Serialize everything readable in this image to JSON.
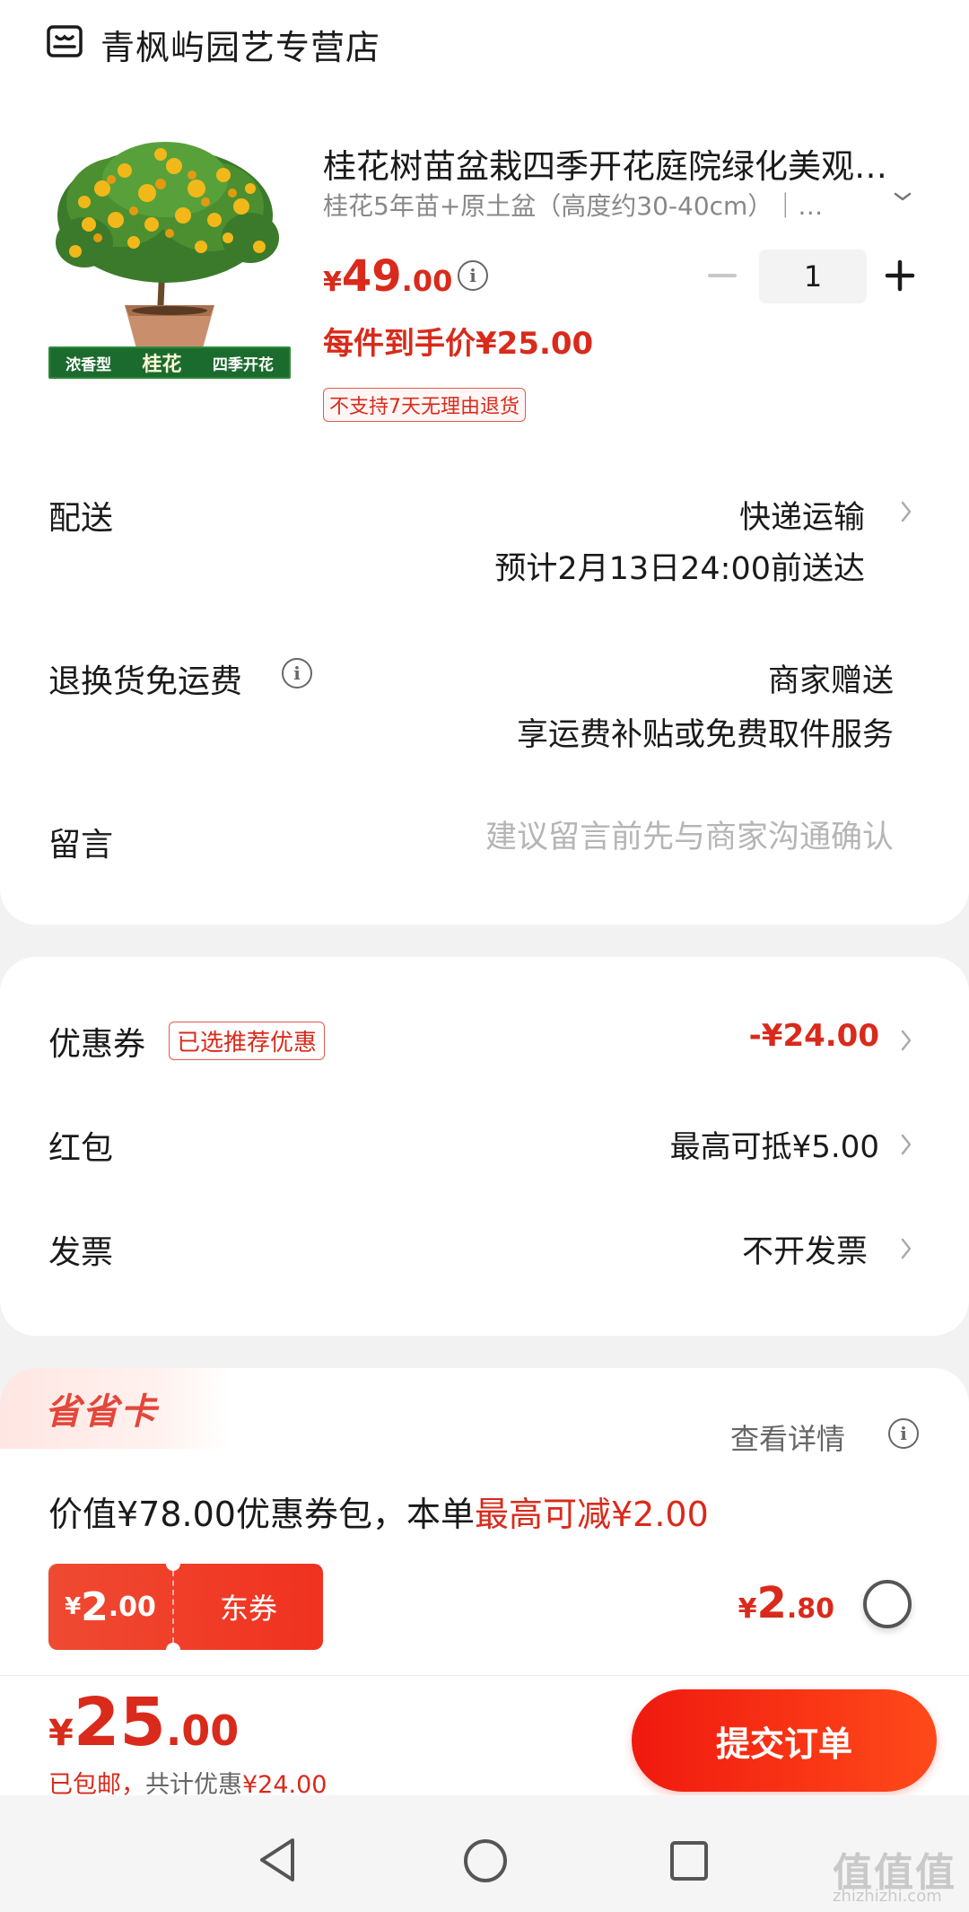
{
  "store": {
    "name": "青枫屿园艺专营店",
    "icon": "store-icon"
  },
  "product": {
    "title": "桂花树苗盆栽四季开花庭院绿化美观…",
    "spec": "桂花5年苗+原土盆（高度约30-40cm）｜…",
    "image_banner": {
      "left": "浓香型",
      "center": "桂花",
      "right": "四季开花"
    },
    "price": {
      "symbol": "¥",
      "integer": "49",
      "decimal": ".00"
    },
    "final_price": "每件到手价¥25.00",
    "return_policy": "不支持7天无理由退货",
    "quantity": "1"
  },
  "shipping": {
    "label": "配送",
    "method": "快递运输",
    "eta": "预计2月13日24:00前送达"
  },
  "return_shipping": {
    "label": "退换货免运费",
    "value": "商家赠送",
    "desc": "享运费补贴或免费取件服务"
  },
  "message": {
    "label": "留言",
    "placeholder": "建议留言前先与商家沟通确认"
  },
  "coupon": {
    "label": "优惠券",
    "badge": "已选推荐优惠",
    "value": "-¥24.00"
  },
  "red_packet": {
    "label": "红包",
    "value": "最高可抵¥5.00"
  },
  "invoice": {
    "label": "发票",
    "value": "不开发票"
  },
  "savings_card": {
    "title": "省省卡",
    "detail": "查看详情",
    "desc_prefix": "价值¥78.00优惠券包，本单",
    "desc_highlight": "最高可减¥2.00",
    "ticket": {
      "symbol": "¥",
      "integer": "2",
      "decimal": ".00",
      "label": "东券"
    },
    "price": {
      "symbol": "¥",
      "integer": "2",
      "decimal": ".80"
    }
  },
  "summary": {
    "total": {
      "symbol": "¥",
      "integer": "25",
      "decimal": ".00"
    },
    "shipping_free": "已包邮，",
    "discount_prefix": "共计优惠",
    "discount_value": "¥24.00",
    "submit": "提交订单"
  },
  "watermark": {
    "main": "值值值",
    "sub": "zhizhizhi.com"
  },
  "colors": {
    "accent": "#d92a1b",
    "button": "#f0190f"
  }
}
